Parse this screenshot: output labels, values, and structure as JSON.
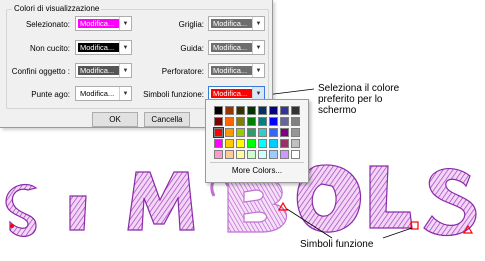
{
  "dialog": {
    "group_title": "Colori di visualizzazione",
    "left_fields": [
      {
        "label": "Selezionato:",
        "value": "Modifica...",
        "color": "#ff00ff",
        "text_color": "#ffffff"
      },
      {
        "label": "Non cucito:",
        "value": "Modifica...",
        "color": "#000000",
        "text_color": "#ffffff"
      },
      {
        "label": "Confini oggetto :",
        "value": "Modifica...",
        "color": "#555555",
        "text_color": "#ffffff"
      },
      {
        "label": "Punte ago:",
        "value": "Modifica...",
        "color": "#ffffff",
        "text_color": "#000000"
      }
    ],
    "right_fields": [
      {
        "label": "Griglia:",
        "value": "Modifica...",
        "color": "#6e6e6e",
        "text_color": "#ffffff"
      },
      {
        "label": "Guida:",
        "value": "Modifica...",
        "color": "#6e6e6e",
        "text_color": "#ffffff"
      },
      {
        "label": "Perforatore:",
        "value": "Modifica...",
        "color": "#6e6e6e",
        "text_color": "#ffffff"
      },
      {
        "label": "Simboli funzione:",
        "value": "Modifica...",
        "color": "#ff0000",
        "text_color": "#ffffff"
      }
    ],
    "ok_label": "OK",
    "cancel_label": "Cancella"
  },
  "color_popup": {
    "palette": [
      [
        "#000000",
        "#993300",
        "#333300",
        "#003300",
        "#003366",
        "#000080",
        "#333399",
        "#333333"
      ],
      [
        "#800000",
        "#ff6600",
        "#808000",
        "#008000",
        "#008080",
        "#0000ff",
        "#666699",
        "#808080"
      ],
      [
        "#ff0000",
        "#ff9900",
        "#99cc00",
        "#339966",
        "#33cccc",
        "#3366ff",
        "#800080",
        "#969696"
      ],
      [
        "#ff00ff",
        "#ffcc00",
        "#ffff00",
        "#00ff00",
        "#00ffff",
        "#00ccff",
        "#993366",
        "#c0c0c0"
      ],
      [
        "#ff99cc",
        "#ffcc99",
        "#ffff99",
        "#ccffcc",
        "#ccffff",
        "#99ccff",
        "#cc99ff",
        "#ffffff"
      ]
    ],
    "more_colors": "More Colors..."
  },
  "annotations": {
    "callout": "Seleziona il colore preferito per lo schermo",
    "callout_lines": [
      "Seleziona il colore",
      "preferito per lo",
      "schermo"
    ],
    "symbols_label": "Simboli funzione"
  },
  "canvas": {
    "lettering": "SIMBOLS",
    "stitch_color": "#a040c0",
    "symbol_color": "#ff0000"
  }
}
